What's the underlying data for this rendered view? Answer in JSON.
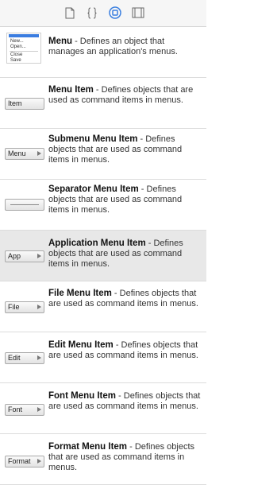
{
  "toolbar": {
    "icons": [
      "file-icon",
      "braces-icon",
      "object-library-icon",
      "media-library-icon"
    ],
    "selected_color": "#3a7fe0"
  },
  "menu_thumbnail": {
    "items": [
      "New...",
      "Open...",
      "Close",
      "Save"
    ]
  },
  "items": [
    {
      "title": "Menu",
      "description": " - Defines an object that manages an application's menus.",
      "thumb": ""
    },
    {
      "title": "Menu Item",
      "description": " - Defines objects that are used as command items in menus.",
      "thumb": "Item"
    },
    {
      "title": "Submenu Menu Item",
      "description": " - Defines objects that are used as command items in menus.",
      "thumb": "Menu"
    },
    {
      "title": "Separator Menu Item",
      "description": " - Defines objects that are used as command items in menus.",
      "thumb": ""
    },
    {
      "title": "Application Menu Item",
      "description": " - Defines objects that are used as command items in menus.",
      "thumb": "App"
    },
    {
      "title": "File Menu Item",
      "description": " - Defines objects that are used as command items in menus.",
      "thumb": "File"
    },
    {
      "title": "Edit Menu Item",
      "description": " - Defines objects that are used as command items in menus.",
      "thumb": "Edit"
    },
    {
      "title": "Font Menu Item",
      "description": " - Defines objects that are used as command items in menus.",
      "thumb": "Font"
    },
    {
      "title": "Format Menu Item",
      "description": " - Defines objects that are used as command items in menus.",
      "thumb": "Format"
    }
  ]
}
